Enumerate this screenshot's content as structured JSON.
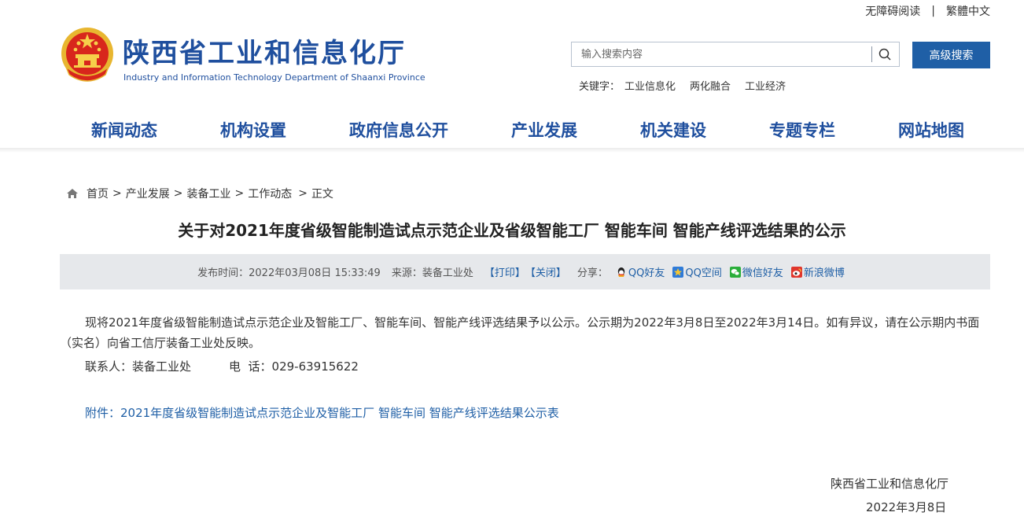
{
  "util": {
    "accessibility": "无障碍阅读",
    "separator": "|",
    "traditional": "繁體中文"
  },
  "header": {
    "title": "陕西省工业和信息化厅",
    "subtitle": "Industry and Information Technology Department of Shaanxi Province"
  },
  "search": {
    "placeholder": "输入搜索内容",
    "advanced_label": "高级搜索",
    "keywords_label": "关键字：",
    "keywords": [
      "工业信息化",
      "两化融合",
      "工业经济"
    ]
  },
  "nav": [
    "新闻动态",
    "机构设置",
    "政府信息公开",
    "产业发展",
    "机关建设",
    "专题专栏",
    "网站地图"
  ],
  "breadcrumb": {
    "items": [
      "首页",
      "产业发展",
      "装备工业",
      "工作动态",
      "正文"
    ],
    "separator": ">"
  },
  "article": {
    "title": "关于对2021年度省级智能制造试点示范企业及省级智能工厂 智能车间 智能产线评选结果的公示",
    "meta": {
      "publish": "发布时间：2022年03月08日 15:33:49",
      "source": "来源：装备工业处",
      "print": "【打印】",
      "close": "【关闭】",
      "share_label": "分享：",
      "share": [
        "QQ好友",
        "QQ空间",
        "微信好友",
        "新浪微博"
      ]
    },
    "paragraph": "现将2021年度省级智能制造试点示范企业及智能工厂、智能车间、智能产线评选结果予以公示。公示期为2022年3月8日至2022年3月14日。如有异议，请在公示期内书面（实名）向省工信厅装备工业处反映。",
    "contact": "联系人：装备工业处",
    "phone": "电  话：029-63915622",
    "attachment": "附件：2021年度省级智能制造试点示范企业及智能工厂 智能车间 智能产线评选结果公示表",
    "sign_org": "陕西省工业和信息化厅",
    "sign_date": "2022年3月8日"
  },
  "colors": {
    "brand": "#1f4f9e",
    "button": "#1f5fa6",
    "meta_bg": "#e6e8eb"
  },
  "icons": [
    "national-emblem-icon",
    "search-icon",
    "home-icon",
    "qq-icon",
    "qzone-icon",
    "wechat-icon",
    "weibo-icon"
  ]
}
